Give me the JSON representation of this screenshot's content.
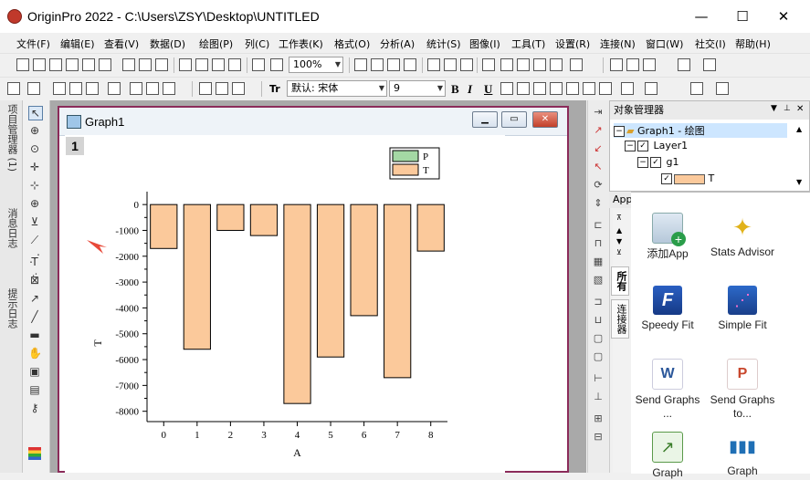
{
  "window": {
    "title": "OriginPro 2022 - C:\\Users\\ZSY\\Desktop\\UNTITLED",
    "minimize": "—",
    "maximize": "☐",
    "close": "✕"
  },
  "menu": [
    "文件(F)",
    "编辑(E)",
    "查看(V)",
    "数据(D)",
    "绘图(P)",
    "列(C)",
    "工作表(K)",
    "格式(O)",
    "分析(A)",
    "统计(S)",
    "图像(I)",
    "工具(T)",
    "设置(R)",
    "连接(N)",
    "窗口(W)",
    "社交(I)",
    "帮助(H)"
  ],
  "toolbar": {
    "zoom": "100%",
    "font_name": "默认: 宋体",
    "font_size": "9",
    "bold": "B",
    "italic": "I",
    "underline": "U",
    "tt_label": "Tr"
  },
  "left_tabs": [
    "项目管理器 (1)",
    "消息日志",
    "提示日志"
  ],
  "graph_window": {
    "title": "Graph1",
    "layer_number": "1"
  },
  "object_manager": {
    "title": "对象管理器",
    "items": [
      "Graph1 - 绘图",
      "Layer1",
      "g1",
      "T"
    ]
  },
  "apps_panel": {
    "title": "Apps",
    "tabs": [
      "所有",
      "连接器"
    ],
    "apps": [
      {
        "label": "添加App",
        "icon": "add-app-icon"
      },
      {
        "label": "Stats Advisor",
        "icon": "stats-advisor-icon"
      },
      {
        "label": "Speedy Fit",
        "icon": "speedy-fit-icon"
      },
      {
        "label": "Simple Fit",
        "icon": "simple-fit-icon"
      },
      {
        "label": "Send Graphs ...",
        "icon": "send-graphs-word-icon"
      },
      {
        "label": "Send Graphs to...",
        "icon": "send-graphs-ppt-icon"
      },
      {
        "label": "Graph",
        "icon": "graph-pub-icon"
      },
      {
        "label": "Graph",
        "icon": "graph-tools-icon"
      }
    ]
  },
  "colors": {
    "bar_fill": "#fbc99b",
    "legend_p": "#a4d8a4",
    "accent_red": "#e84a3a",
    "selection": "#cde6ff"
  },
  "chart_data": {
    "type": "bar",
    "categories": [
      "0",
      "1",
      "2",
      "3",
      "4",
      "5",
      "6",
      "7",
      "8"
    ],
    "series": [
      {
        "name": "T",
        "values": [
          -1700,
          -5600,
          -1000,
          -1200,
          -7700,
          -5900,
          -4300,
          -6700,
          -1800
        ]
      }
    ],
    "legend": [
      "P",
      "T"
    ],
    "legend_position": "top-right",
    "xlabel": "A",
    "ylabel": "T",
    "ylim": [
      -8400,
      500
    ],
    "yticks": [
      0,
      -1000,
      -2000,
      -3000,
      -4000,
      -5000,
      -6000,
      -7000,
      -8000
    ],
    "grid": false
  }
}
